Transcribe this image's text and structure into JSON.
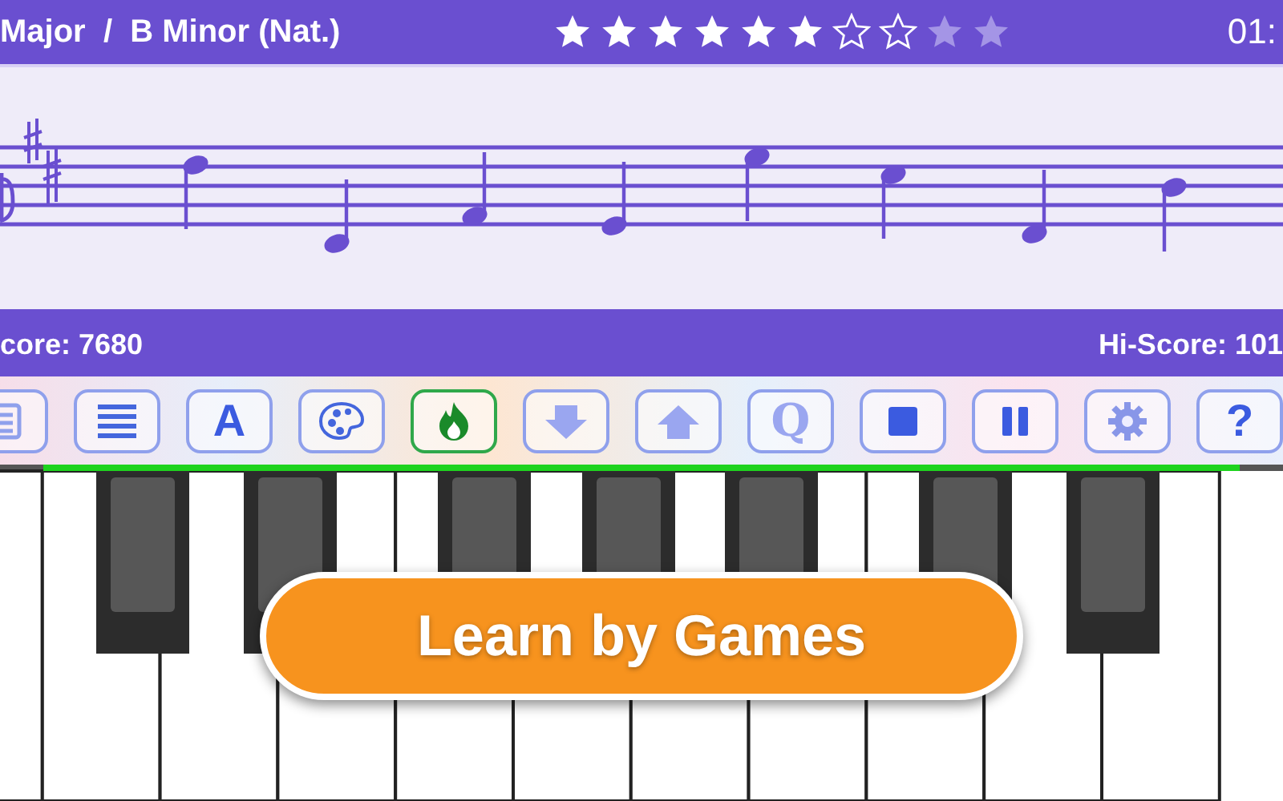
{
  "top_bar": {
    "title": "Major  /  B Minor (Nat.)",
    "rating": {
      "stars": 6,
      "empty": [
        {
          "kind": "outline"
        },
        {
          "kind": "outline"
        },
        {
          "kind": "faded"
        },
        {
          "kind": "faded"
        }
      ]
    },
    "timer": "01:"
  },
  "score_bar": {
    "score": "core: 7680",
    "hi_score": "Hi-Score: 101"
  },
  "toolbar": [
    {
      "kind": "document",
      "selected": false
    },
    {
      "kind": "menu",
      "selected": false
    },
    {
      "kind": "letter",
      "label": "A",
      "selected": false
    },
    {
      "kind": "palette",
      "selected": false
    },
    {
      "kind": "flame",
      "selected": true
    },
    {
      "kind": "down",
      "selected": false
    },
    {
      "kind": "up",
      "selected": false
    },
    {
      "kind": "letter",
      "label": "Q",
      "selected": false
    },
    {
      "kind": "stop",
      "selected": false
    },
    {
      "kind": "pause",
      "selected": false
    },
    {
      "kind": "gear",
      "selected": false
    },
    {
      "kind": "letter",
      "label": "?",
      "selected": false
    }
  ],
  "banner": {
    "label": "Learn by Games"
  }
}
